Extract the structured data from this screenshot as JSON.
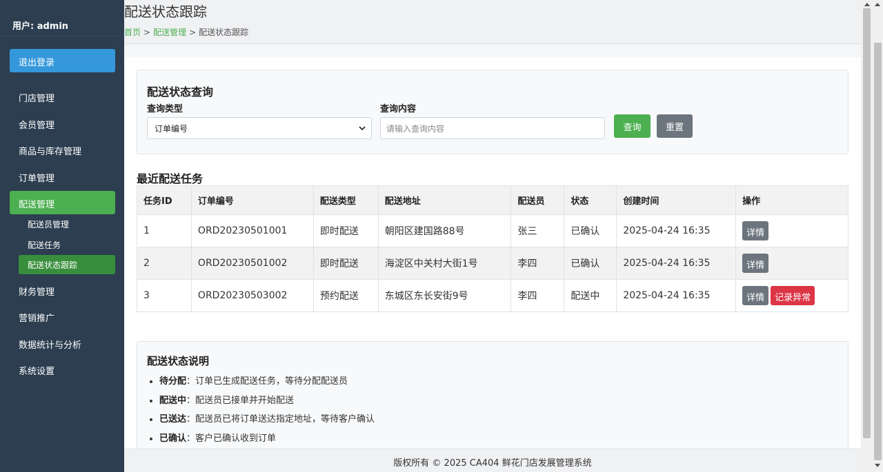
{
  "sidebar": {
    "user_label": "用户: admin",
    "logout": "退出登录",
    "items": [
      {
        "label": "门店管理"
      },
      {
        "label": "会员管理"
      },
      {
        "label": "商品与库存管理"
      },
      {
        "label": "订单管理"
      },
      {
        "label": "配送管理"
      },
      {
        "label": "财务管理"
      },
      {
        "label": "营销推广"
      },
      {
        "label": "数据统计与分析"
      },
      {
        "label": "系统设置"
      }
    ],
    "sub_items": [
      {
        "label": "配送员管理"
      },
      {
        "label": "配送任务"
      },
      {
        "label": "配送状态跟踪"
      }
    ]
  },
  "header": {
    "title": "配送状态跟踪",
    "breadcrumb": [
      "首页",
      "配送管理",
      "配送状态跟踪"
    ],
    "separator": ">"
  },
  "query": {
    "title": "配送状态查询",
    "type_label": "查询类型",
    "type_value": "订单编号",
    "content_label": "查询内容",
    "content_placeholder": "请输入查询内容",
    "query_button": "查询",
    "reset_button": "重置"
  },
  "tasks": {
    "title": "最近配送任务",
    "columns": [
      "任务ID",
      "订单编号",
      "配送类型",
      "配送地址",
      "配送员",
      "状态",
      "创建时间",
      "操作"
    ],
    "rows": [
      {
        "id": "1",
        "order": "ORD20230501001",
        "type": "即时配送",
        "address": "朝阳区建国路88号",
        "courier": "张三",
        "status": "已确认",
        "created": "2025-04-24 16:35",
        "detail": "详情"
      },
      {
        "id": "2",
        "order": "ORD20230501002",
        "type": "即时配送",
        "address": "海淀区中关村大街1号",
        "courier": "李四",
        "status": "已确认",
        "created": "2025-04-24 16:35",
        "detail": "详情"
      },
      {
        "id": "3",
        "order": "ORD20230503002",
        "type": "预约配送",
        "address": "东城区东长安街9号",
        "courier": "李四",
        "status": "配送中",
        "created": "2025-04-24 16:35",
        "detail": "详情",
        "exception": "记录异常"
      }
    ]
  },
  "description": {
    "title": "配送状态说明",
    "items": [
      {
        "term": "待分配",
        "text": "：订单已生成配送任务，等待分配配送员"
      },
      {
        "term": "配送中",
        "text": "：配送员已接单并开始配送"
      },
      {
        "term": "已送达",
        "text": "：配送员已将订单送达指定地址，等待客户确认"
      },
      {
        "term": "已确认",
        "text": "：客户已确认收到订单"
      }
    ]
  },
  "footer": {
    "text": "版权所有 © 2025 CA404 鲜花门店发展管理系统"
  },
  "colors": {
    "sidebar_bg": "#2c3e50",
    "logout_bg": "#3498db",
    "active_nav": "#4caf50",
    "active_sub": "#388e3c",
    "query_btn": "#4caf50",
    "secondary_btn": "#6c757d",
    "danger_btn": "#dc3545"
  }
}
